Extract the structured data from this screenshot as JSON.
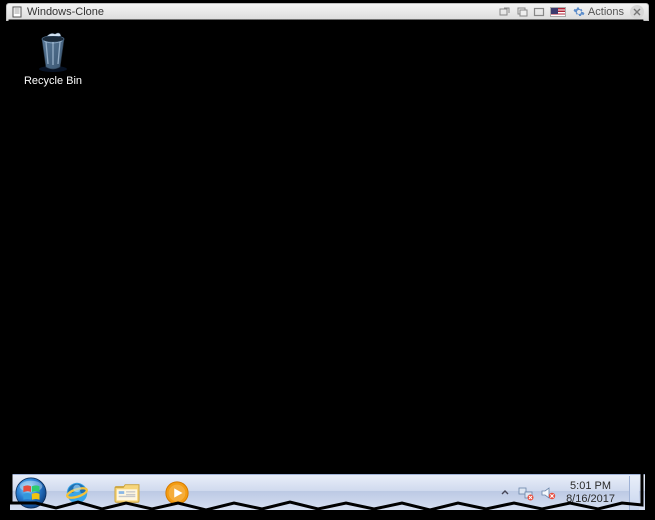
{
  "titlebar": {
    "title": "Windows-Clone",
    "actions_label": "Actions"
  },
  "desktop": {
    "recycle_bin_label": "Recycle Bin"
  },
  "tray": {
    "time": "5:01 PM",
    "date": "8/16/2017"
  }
}
